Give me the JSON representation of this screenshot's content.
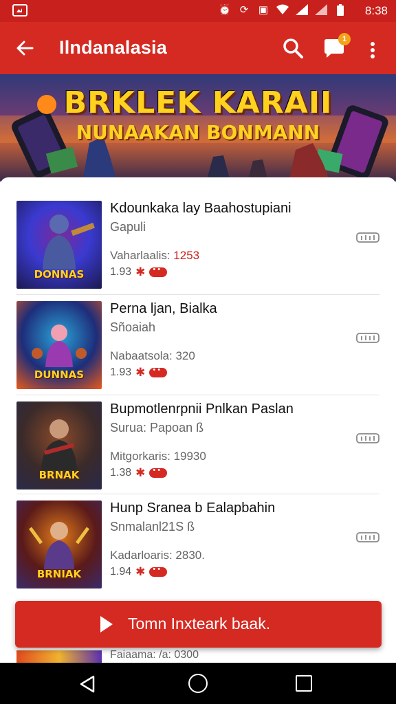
{
  "status_bar": {
    "time": "8:38",
    "icons": [
      "gallery-icon",
      "alarm-icon",
      "sync-icon",
      "vibrate-icon",
      "wifi-icon",
      "signal-icon",
      "signal-icon",
      "battery-icon"
    ]
  },
  "app_bar": {
    "title": "Ilndanalasia",
    "chat_badge": "1",
    "icons": [
      "back-arrow-icon",
      "search-icon",
      "chat-icon",
      "more-vert-icon"
    ]
  },
  "banner": {
    "title": "BRKLEK KARAII",
    "subtitle": "NUNAAKAN BONMANN"
  },
  "items": [
    {
      "title": "Kdounkaka lay Baahostupiani",
      "subtitle": "Gapuli",
      "meta_label": "Vaharlaalis: ",
      "meta_number": "1253",
      "rating": "1.93",
      "thumb_label": "DONNAS",
      "thumb_colors": [
        "#1b1a4f",
        "#3a3ad0",
        "#7b2a9a"
      ],
      "action_icon": "download-icon"
    },
    {
      "title": "Perna ljan, Bialka",
      "subtitle": "Sñoaiah",
      "meta_label": "Nabaatsola: 320",
      "meta_number": "",
      "rating": "1.93",
      "thumb_label": "DUNNAS",
      "thumb_colors": [
        "#1e2d7a",
        "#2aa3d8",
        "#e85a1a"
      ],
      "action_icon": "download-icon"
    },
    {
      "title": "Bupmotlenrpnii Pnlkan Paslan",
      "subtitle": "Surua: Papoan ß",
      "meta_label": "Mitgorkaris: 19930",
      "meta_number": "",
      "rating": "1.38",
      "thumb_label": "BRNAK",
      "thumb_colors": [
        "#3a2a2a",
        "#8a4a2a",
        "#2a2a4a"
      ],
      "action_icon": "download-icon"
    },
    {
      "title": "Hunp Sranea b Ealapbahin",
      "subtitle": "Snmalanl21S ß",
      "meta_label": "Kadarloaris: 2830.",
      "meta_number": "",
      "rating": "1.94",
      "thumb_label": "BRNIAK",
      "thumb_colors": [
        "#5a1a1a",
        "#e07a1a",
        "#3a2a6a"
      ],
      "action_icon": "download-icon"
    }
  ],
  "main_button": {
    "label": "Tomn Inxteark baak."
  },
  "peek_item": {
    "meta_label": "Faiaama: /a: 0300"
  },
  "nav_bar": {
    "icons": [
      "nav-back-icon",
      "nav-home-icon",
      "nav-recents-icon"
    ]
  },
  "colors": {
    "primary": "#d42a22",
    "status_bar": "#c8201c",
    "accent_badge": "#f2a21b"
  }
}
